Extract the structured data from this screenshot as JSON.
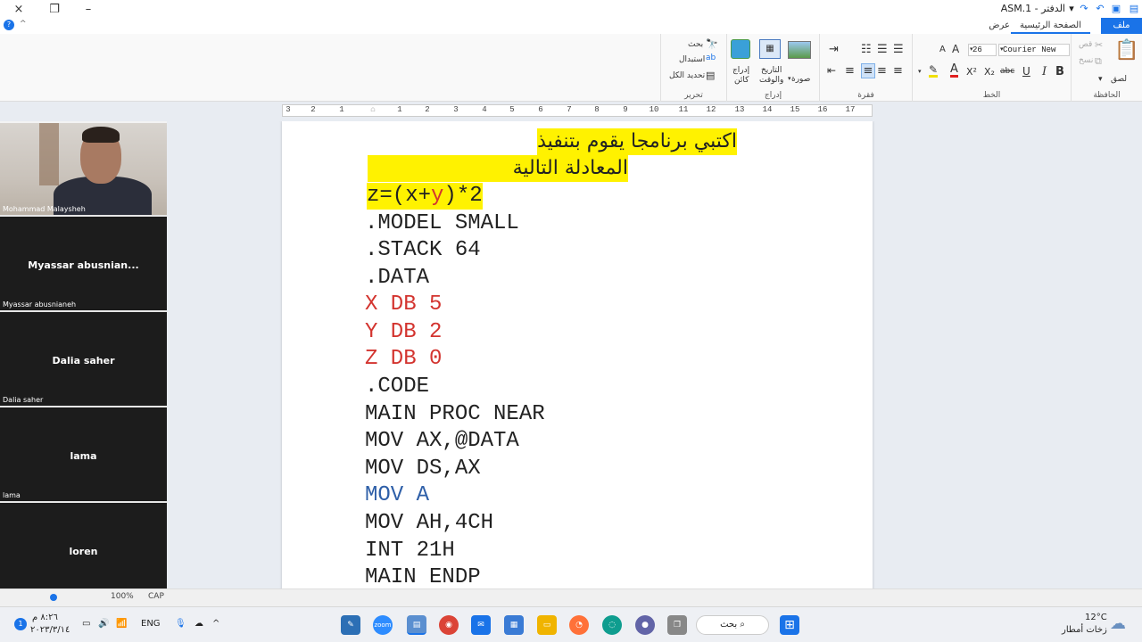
{
  "window": {
    "title": "ASM.1 - الدفتر",
    "close_icon": "×",
    "restore_icon": "❐",
    "minimize_icon": "–"
  },
  "tabs": {
    "file": "ملف",
    "home": "الصفحة الرئيسية",
    "view": "عرض"
  },
  "ribbon": {
    "clipboard": {
      "label": "الحافظة",
      "paste": "لصق",
      "cut": "قص",
      "copy": "نسخ"
    },
    "font": {
      "label": "الخط",
      "family": "Courier New",
      "size": "26",
      "bold": "B",
      "italic": "I",
      "underline": "U",
      "strike": "abc",
      "subscript": "X₂",
      "superscript": "X²",
      "color": "A",
      "grow": "A",
      "shrink": "A"
    },
    "paragraph": {
      "label": "فقرة"
    },
    "insert": {
      "label": "إدراج",
      "picture": "صورة",
      "datetime_1": "التاريخ",
      "datetime_2": "والوقت",
      "object_1": "إدراج",
      "object_2": "كائن"
    },
    "editing": {
      "label": "تحرير",
      "find": "بحث",
      "replace": "استبدال",
      "select_all": "تحديد الكل"
    }
  },
  "ruler": {
    "numbers": [
      "3",
      "2",
      "1",
      "1",
      "2",
      "3",
      "4",
      "5",
      "6",
      "7",
      "8",
      "9",
      "10",
      "11",
      "12",
      "13",
      "14",
      "15",
      "16",
      "17"
    ]
  },
  "document": {
    "lines": [
      {
        "text": "اكتبي برنامجا يقوم بتنفيذ",
        "style": "arabic-hl"
      },
      {
        "text": "المعادلة التالية",
        "style": "arabic-hl"
      },
      {
        "text": "z=(x+y)*2",
        "style": "formula"
      },
      {
        "text": ".MODEL SMALL",
        "style": "plain"
      },
      {
        "text": ".STACK 64",
        "style": "plain"
      },
      {
        "text": ".DATA",
        "style": "plain"
      },
      {
        "text": "X DB 5",
        "style": "red"
      },
      {
        "text": "Y DB 2",
        "style": "red"
      },
      {
        "text": "Z DB 0",
        "style": "red"
      },
      {
        "text": ".CODE",
        "style": "plain"
      },
      {
        "text": "MAIN PROC NEAR",
        "style": "plain"
      },
      {
        "text": "MOV AX,@DATA",
        "style": "plain"
      },
      {
        "text": "MOV DS,AX",
        "style": "plain"
      },
      {
        "text": "MOV A",
        "style": "blue"
      },
      {
        "text": "MOV AH,4CH",
        "style": "plain"
      },
      {
        "text": "INT 21H",
        "style": "plain"
      },
      {
        "text": "MAIN ENDP",
        "style": "plain"
      }
    ],
    "formula": {
      "pre": "z=(x+",
      "y": "y",
      "post": ")*2"
    }
  },
  "participants": [
    {
      "center": "",
      "label": "Mohammad Malaysheh"
    },
    {
      "center": "Myassar  abusnian...",
      "label": "Myassar abusnianeh"
    },
    {
      "center": "Dalia saher",
      "label": "Dalia saher"
    },
    {
      "center": "lama",
      "label": "lama"
    },
    {
      "center": "loren",
      "label": "loren"
    }
  ],
  "statusbar": {
    "zoom": "100%",
    "caps": "CAP"
  },
  "taskbar": {
    "search": "بحث",
    "weather_temp": "12°C",
    "weather_desc": "زخات أمطار",
    "language": "ENG",
    "time": "٨:٢٦ م",
    "date": "٢٠٢٣/٣/١٤",
    "zoom_label": "zoom"
  },
  "colors": {
    "accent": "#1a73e8",
    "highlight": "#fff200",
    "code_red": "#d3342f",
    "code_blue": "#2e5fa8"
  }
}
